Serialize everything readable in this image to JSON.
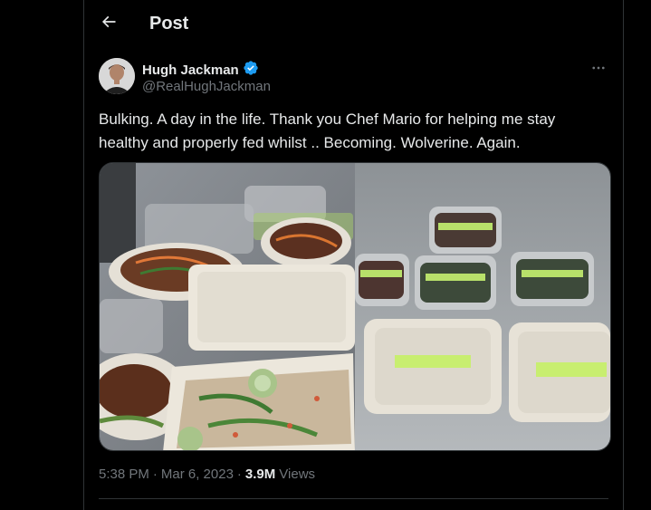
{
  "header": {
    "title": "Post",
    "back_icon": "arrow-left-icon"
  },
  "author": {
    "name": "Hugh Jackman",
    "handle": "@RealHughJackman",
    "verified_icon": "verified-badge-icon",
    "verified_color": "#1d9bf0"
  },
  "tweet": {
    "text": "Bulking.  A day in the life. Thank you Chef Mario for helping me stay healthy and properly fed whilst .. Becoming. Wolverine. Again."
  },
  "media": {
    "left_image_icon": "meal-prep-photo-1",
    "right_image_icon": "meal-prep-photo-2"
  },
  "meta": {
    "time": "5:38 PM",
    "separator": "·",
    "date": "Mar 6, 2023",
    "views_count": "3.9M",
    "views_label": "Views"
  },
  "colors": {
    "background": "#000000",
    "text_primary": "#e7e9ea",
    "text_secondary": "#71767b",
    "border": "#2f3336"
  }
}
